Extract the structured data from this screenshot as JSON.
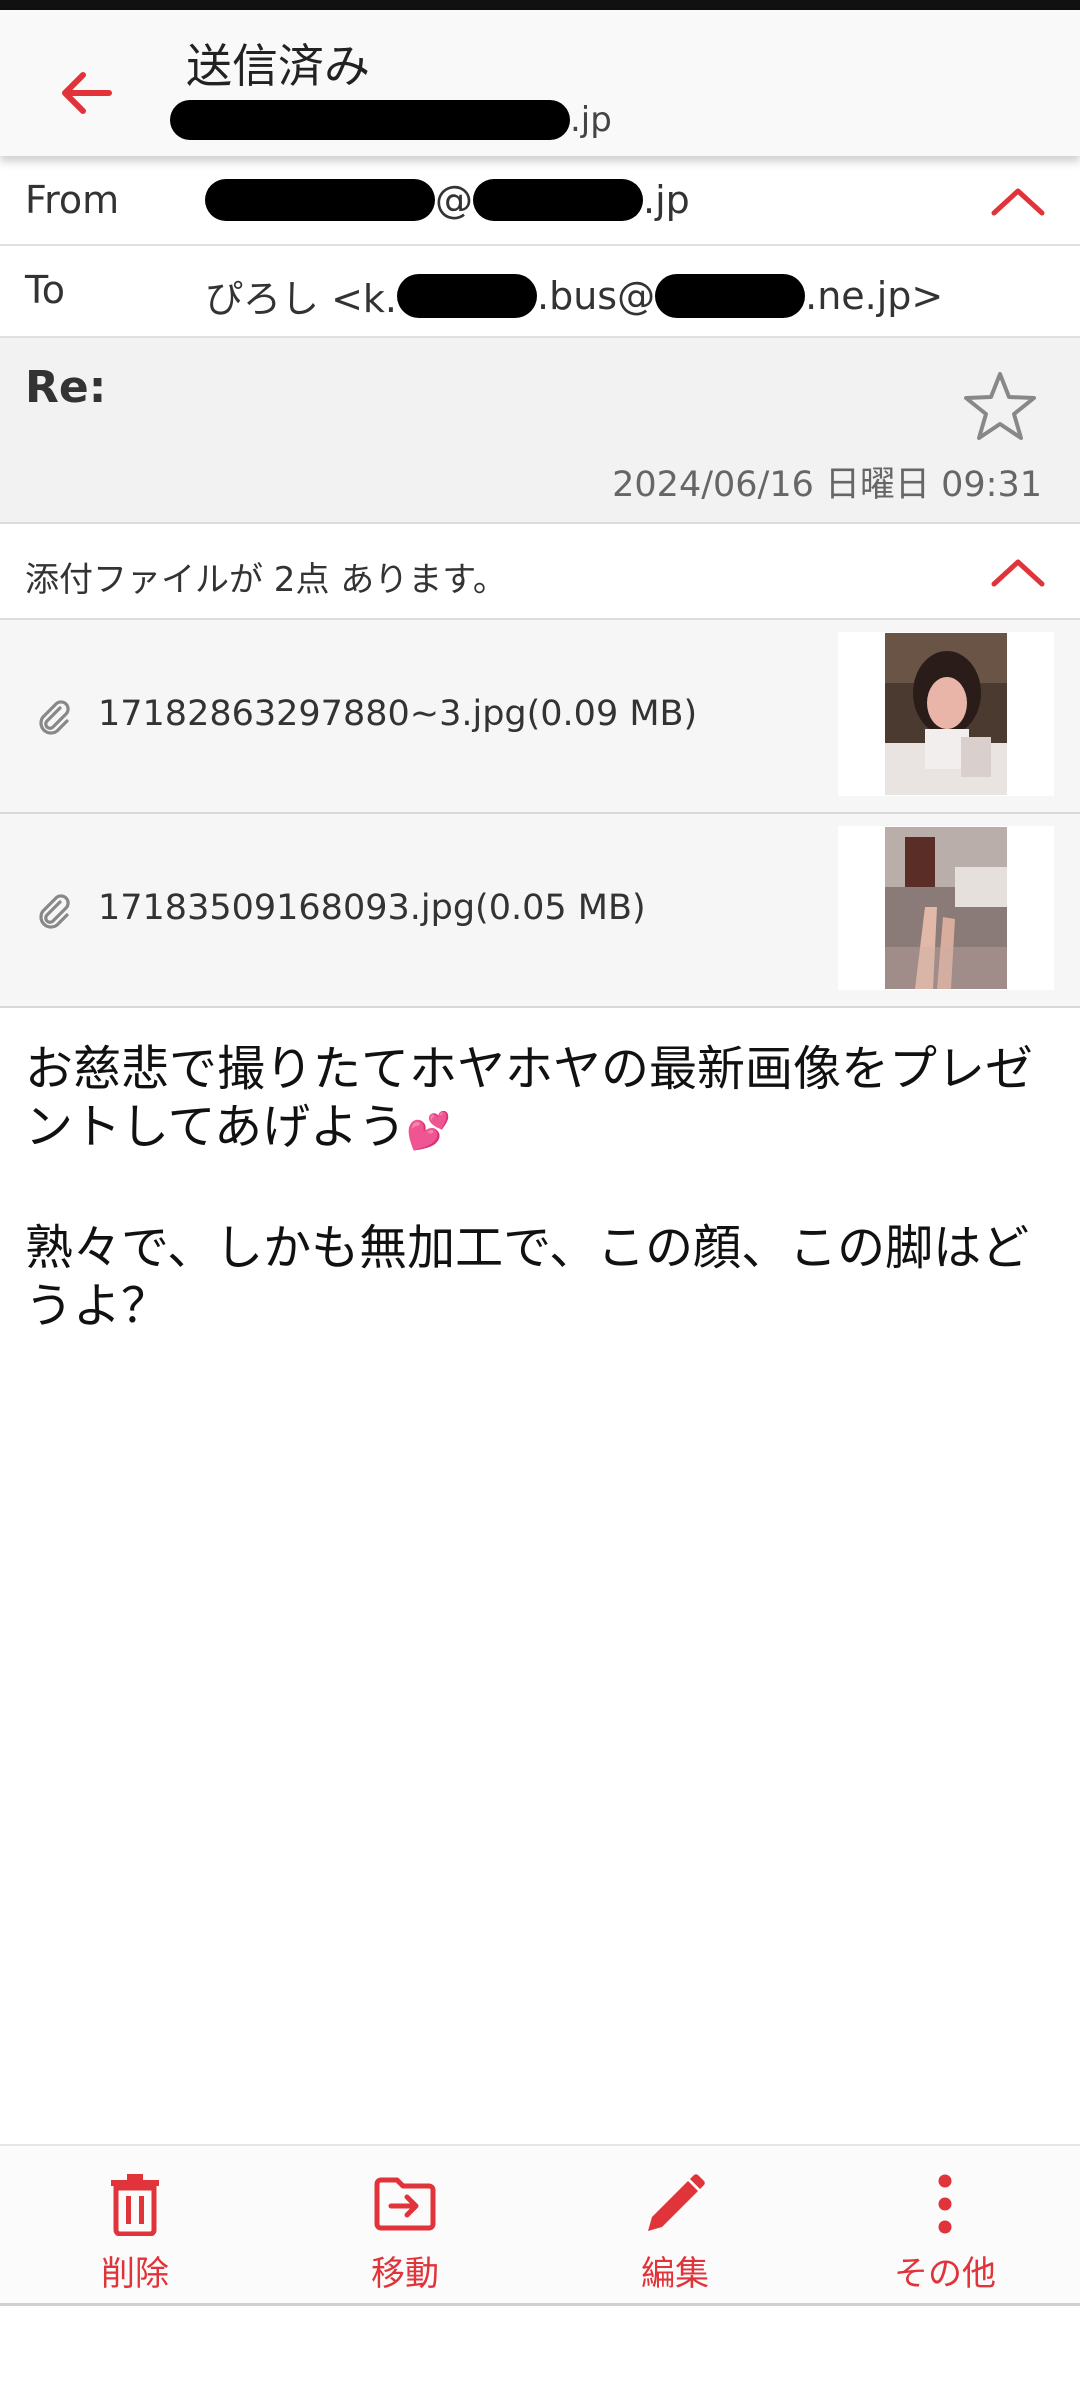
{
  "app_bar": {
    "title": "送信済み",
    "subtitle_suffix": ".jp",
    "back_icon": "arrow-left-icon"
  },
  "header": {
    "from_label": "From",
    "from_value_mid": "@",
    "from_value_suffix": ".jp",
    "to_label": "To",
    "to_value_prefix": "ぴろし <k.",
    "to_value_mid": ".bus@",
    "to_value_suffix": ".ne.jp>"
  },
  "subject": {
    "text": "Re:",
    "date": "2024/06/16 日曜日 09:31"
  },
  "attachments": {
    "summary": "添付ファイルが 2点 あります。",
    "items": [
      {
        "name": "17182863297880~3.jpg(0.09 MB)"
      },
      {
        "name": "17183509168093.jpg(0.05 MB)"
      }
    ]
  },
  "body": {
    "paragraph1": "お慈悲で撮りたてホヤホヤの最新画像をプレゼントしてあげよう",
    "heart": "💕",
    "paragraph2": "熟々で、しかも無加工で、この顔、この脚はどうよ？"
  },
  "bottom_nav": {
    "items": [
      {
        "label": "削除",
        "icon": "trash-icon"
      },
      {
        "label": "移動",
        "icon": "move-folder-icon"
      },
      {
        "label": "編集",
        "icon": "pencil-icon"
      },
      {
        "label": "その他",
        "icon": "more-vertical-icon"
      }
    ]
  },
  "colors": {
    "accent": "#e0333a",
    "header_bg": "#f9f9f9",
    "subject_bg": "#f2f2f2",
    "attachment_bg": "#f6f6f6"
  }
}
